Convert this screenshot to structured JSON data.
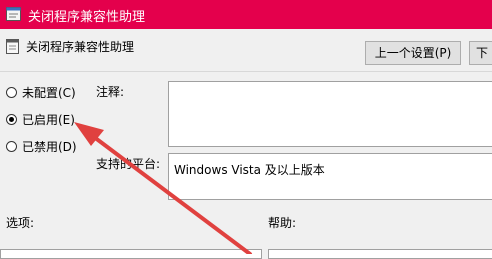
{
  "window": {
    "title": "关闭程序兼容性助理",
    "colors": {
      "titlebar": "#e4004c",
      "arrow": "#e0413f"
    }
  },
  "policy": {
    "name": "关闭程序兼容性助理",
    "prev_button": "上一个设置(P)",
    "next_button": "下"
  },
  "state": {
    "options": [
      {
        "label": "未配置(C)",
        "selected": false
      },
      {
        "label": "已启用(E)",
        "selected": true
      },
      {
        "label": "已禁用(D)",
        "selected": false
      }
    ]
  },
  "fields": {
    "comment_label": "注释:",
    "comment_value": "",
    "platform_label": "支持的平台:",
    "platform_value": "Windows Vista 及以上版本"
  },
  "panes": {
    "options_label": "选项:",
    "help_label": "帮助:"
  }
}
